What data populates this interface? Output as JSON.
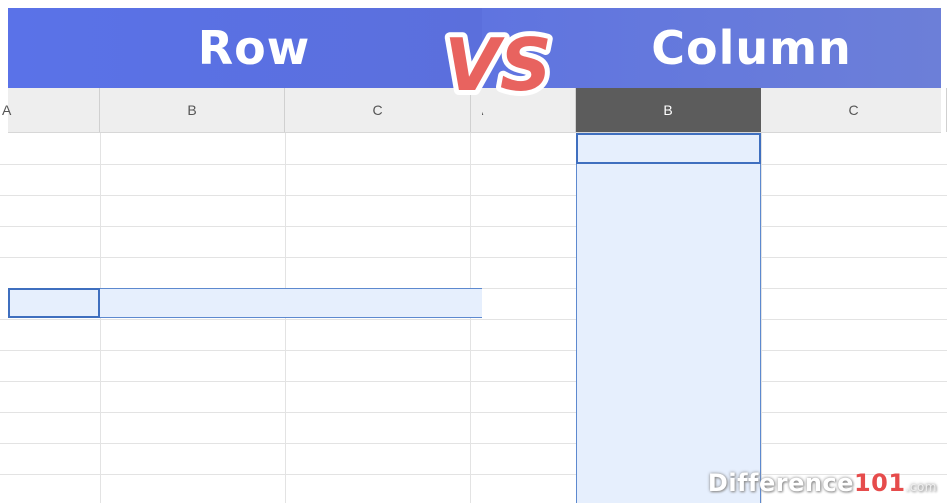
{
  "left": {
    "title": "Row",
    "columns": [
      "A",
      "B",
      "C"
    ]
  },
  "right": {
    "title": "Column",
    "columns": [
      "A",
      "B",
      "C"
    ],
    "active_column": "B"
  },
  "vs_label": "VS",
  "watermark": {
    "name": "Difference",
    "number": "101",
    "tld": ".com"
  },
  "colors": {
    "banner": "#5b72e6",
    "selection_fill": "#e6effd",
    "selection_border": "#3f6fbf",
    "vs_fill": "#e8635f"
  }
}
